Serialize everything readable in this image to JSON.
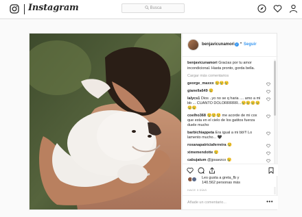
{
  "topbar": {
    "brand": "Instagram",
    "search_placeholder": "Busca"
  },
  "post": {
    "author": "benjavicunamori",
    "follow_label": "Seguir",
    "caption_user": "benjavicunamori",
    "caption_text": "Gracias por tu amor incondicional. Hasta pronto, gorda bella.",
    "load_more": "Cargar más comentarios",
    "comments": [
      {
        "user": "george_maxxx",
        "text": "😢😢😢"
      },
      {
        "user": "gianella649",
        "text": "😢"
      },
      {
        "user": "lalycs1",
        "text": "Dios ..yo no se q haria .... amo a mi bb ... CUANTO DOLORRRRR...😢😢😢😢😢😢"
      },
      {
        "user": "coelho368",
        "text": "😢😢😢 me acorde de mi cox que esta en el cielo de los gatitos fuerza duele mucho"
      },
      {
        "user": "barbichiappeta",
        "text": "Era igual a mi bb!!! Lo lamento mucho... 🖤"
      },
      {
        "user": "roxanapatriciaferreira",
        "text": "😢"
      },
      {
        "user": "ximemendotte",
        "text": "😢"
      },
      {
        "user": "cabujatum",
        "text": "@jpsaezco 😢"
      }
    ],
    "likes_line1": "Les gusta a greta_fb y",
    "likes_line2": "140.562 personas más",
    "date": "HACE 3 DÍAS",
    "add_comment_placeholder": "Añade un comentario...",
    "more_label": "•••"
  },
  "colors": {
    "accent": "#3897f0",
    "border": "#dbdbdb",
    "background": "#fafafa"
  },
  "icons": [
    "instagram-icon",
    "search-icon",
    "compass-icon",
    "heart-icon",
    "profile-icon",
    "verified-icon",
    "like-icon",
    "comment-icon",
    "share-icon",
    "bookmark-icon"
  ]
}
